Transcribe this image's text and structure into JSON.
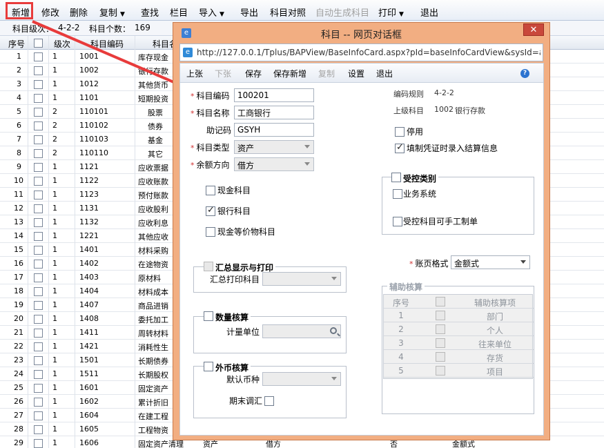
{
  "toolbar": {
    "items": [
      {
        "label": "新增",
        "dropdown": false,
        "disabled": false
      },
      {
        "label": "修改",
        "dropdown": false,
        "disabled": false
      },
      {
        "label": "删除",
        "dropdown": false,
        "disabled": false
      },
      {
        "label": "复制",
        "dropdown": true,
        "disabled": false
      },
      {
        "label": "查找",
        "dropdown": false,
        "disabled": false
      },
      {
        "label": "栏目",
        "dropdown": false,
        "disabled": false
      },
      {
        "label": "导入",
        "dropdown": true,
        "disabled": false
      },
      {
        "label": "导出",
        "dropdown": false,
        "disabled": false
      },
      {
        "label": "科目对照",
        "dropdown": false,
        "disabled": false
      },
      {
        "label": "自动生成科目",
        "dropdown": false,
        "disabled": true
      },
      {
        "label": "打印",
        "dropdown": true,
        "disabled": false
      },
      {
        "label": "退出",
        "dropdown": false,
        "disabled": false
      }
    ],
    "dropdown_glyph": "▼"
  },
  "infobar": {
    "level_label": "科目级次：",
    "level_value": "4-2-2",
    "count_label": "科目个数：",
    "count_value": "169"
  },
  "grid": {
    "columns": [
      "序号",
      "",
      "级次",
      "科目编码",
      "科目名"
    ],
    "rows": [
      {
        "no": "1",
        "level": "1",
        "code": "1001",
        "name": "库存现金"
      },
      {
        "no": "2",
        "level": "1",
        "code": "1002",
        "name": "银行存款"
      },
      {
        "no": "3",
        "level": "1",
        "code": "1012",
        "name": "其他货币"
      },
      {
        "no": "4",
        "level": "1",
        "code": "1101",
        "name": "短期投资"
      },
      {
        "no": "5",
        "level": "2",
        "code": "110101",
        "name": "股票"
      },
      {
        "no": "6",
        "level": "2",
        "code": "110102",
        "name": "债券"
      },
      {
        "no": "7",
        "level": "2",
        "code": "110103",
        "name": "基金"
      },
      {
        "no": "8",
        "level": "2",
        "code": "110110",
        "name": "其它"
      },
      {
        "no": "9",
        "level": "1",
        "code": "1121",
        "name": "应收票据"
      },
      {
        "no": "10",
        "level": "1",
        "code": "1122",
        "name": "应收账款"
      },
      {
        "no": "11",
        "level": "1",
        "code": "1123",
        "name": "预付账款"
      },
      {
        "no": "12",
        "level": "1",
        "code": "1131",
        "name": "应收股利"
      },
      {
        "no": "13",
        "level": "1",
        "code": "1132",
        "name": "应收利息"
      },
      {
        "no": "14",
        "level": "1",
        "code": "1221",
        "name": "其他应收"
      },
      {
        "no": "15",
        "level": "1",
        "code": "1401",
        "name": "材料采购"
      },
      {
        "no": "16",
        "level": "1",
        "code": "1402",
        "name": "在途物资"
      },
      {
        "no": "17",
        "level": "1",
        "code": "1403",
        "name": "原材料"
      },
      {
        "no": "18",
        "level": "1",
        "code": "1404",
        "name": "材料成本"
      },
      {
        "no": "19",
        "level": "1",
        "code": "1407",
        "name": "商品进销"
      },
      {
        "no": "20",
        "level": "1",
        "code": "1408",
        "name": "委托加工"
      },
      {
        "no": "21",
        "level": "1",
        "code": "1411",
        "name": "周转材料"
      },
      {
        "no": "22",
        "level": "1",
        "code": "1421",
        "name": "消耗性生"
      },
      {
        "no": "23",
        "level": "1",
        "code": "1501",
        "name": "长期债券"
      },
      {
        "no": "24",
        "level": "1",
        "code": "1511",
        "name": "长期股权"
      },
      {
        "no": "25",
        "level": "1",
        "code": "1601",
        "name": "固定资产"
      },
      {
        "no": "26",
        "level": "1",
        "code": "1602",
        "name": "累计折旧"
      },
      {
        "no": "27",
        "level": "1",
        "code": "1604",
        "name": "在建工程"
      },
      {
        "no": "28",
        "level": "1",
        "code": "1605",
        "name": "工程物资"
      },
      {
        "no": "29",
        "level": "1",
        "code": "1606",
        "name": "固定资产清理",
        "type": "资产",
        "direction": "借方",
        "flag": "否",
        "format": "金额式"
      }
    ]
  },
  "dialog": {
    "title": "科目 -- 网页对话框",
    "close_glyph": "✕",
    "app_icon": "ie-icon",
    "url": "http://127.0.0.1/Tplus/BAPView/BaseInfoCard.aspx?pId=baseInfoCardView&sysId=aat",
    "toolbar": [
      {
        "label": "上张",
        "disabled": false
      },
      {
        "label": "下张",
        "disabled": true
      },
      {
        "label": "保存",
        "disabled": false
      },
      {
        "label": "保存新增",
        "disabled": false
      },
      {
        "label": "复制",
        "disabled": true
      },
      {
        "label": "设置",
        "disabled": false
      },
      {
        "label": "退出",
        "disabled": false
      }
    ],
    "help_glyph": "?",
    "form": {
      "code_label": "科目编码",
      "code_value": "100201",
      "name_label": "科目名称",
      "name_value": "工商银行",
      "mnemonic_label": "助记码",
      "mnemonic_value": "GSYH",
      "type_label": "科目类型",
      "type_value": "资产",
      "direction_label": "余额方向",
      "direction_value": "借方",
      "rule_label": "编码规则",
      "rule_value": "4-2-2",
      "parent_label": "上级科目",
      "parent_value": "1002",
      "parent_name": "银行存款",
      "disable_label": "停用",
      "settle_label": "填制凭证时录入结算信息",
      "cash_label": "现金科目",
      "bank_label": "银行科目",
      "cash_equiv_label": "现金等价物科目",
      "controlled_title": "受控类别",
      "biz_system_label": "业务系统",
      "manual_label": "受控科目可手工制单",
      "summary_title": "汇总显示与打印",
      "summary_print_label": "汇总打印科目",
      "page_format_label": "账页格式",
      "page_format_value": "金额式",
      "qty_title": "数量核算",
      "unit_label": "计量单位",
      "fx_title": "外币核算",
      "currency_label": "默认币种",
      "period_adj_label": "期末调汇",
      "aux_title": "辅助核算",
      "aux_columns": [
        "序号",
        "",
        "辅助核算项"
      ],
      "aux_rows": [
        {
          "no": "1",
          "item": "部门"
        },
        {
          "no": "2",
          "item": "个人"
        },
        {
          "no": "3",
          "item": "往来单位"
        },
        {
          "no": "4",
          "item": "存货"
        },
        {
          "no": "5",
          "item": "项目"
        }
      ],
      "required_mark": "*"
    }
  },
  "colors": {
    "highlight": "#e83b3b",
    "dialog_frame": "#f2ae82",
    "close_button": "#c9483b"
  }
}
